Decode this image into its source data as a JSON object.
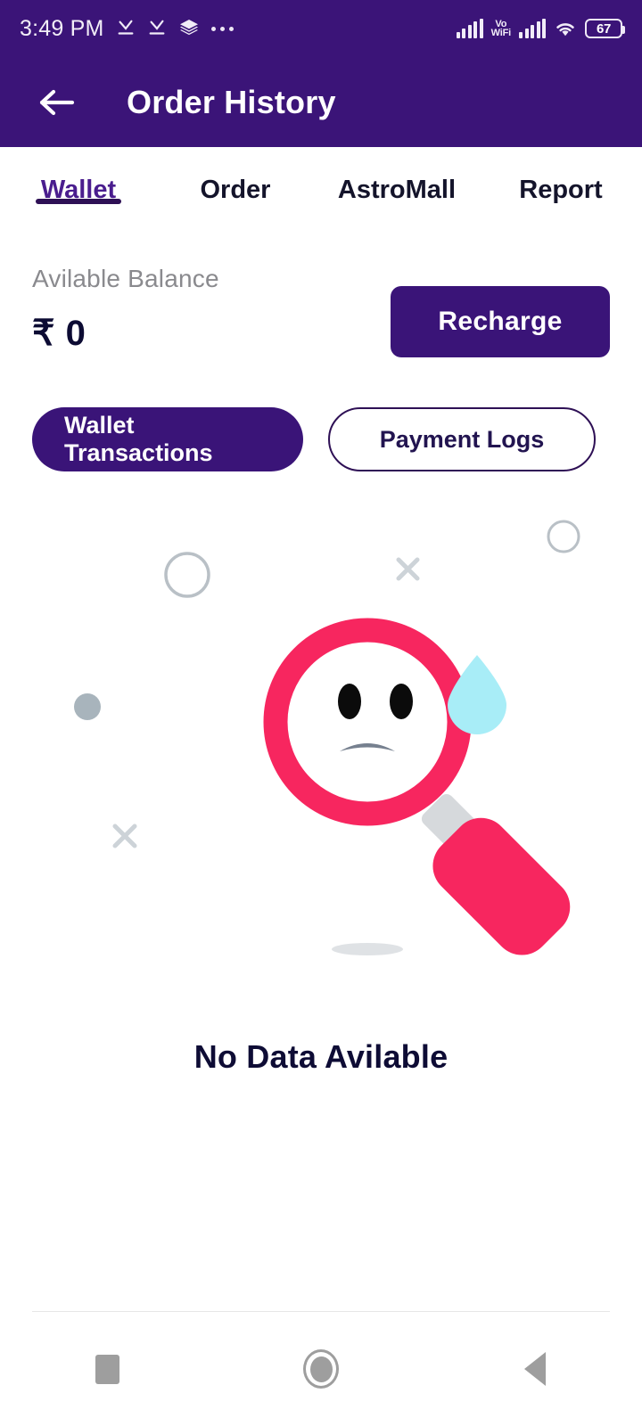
{
  "statusbar": {
    "time": "3:49 PM",
    "battery_percent": "67",
    "volte_label_line1": "Vo",
    "volte_label_line2": "WiFi",
    "icons": [
      "check-download-icon",
      "check-download-icon",
      "layers-icon",
      "more-dots-icon",
      "signal-bars-icon",
      "vowifi-icon",
      "signal-bars-icon",
      "wifi-icon",
      "battery-icon"
    ]
  },
  "appbar": {
    "title": "Order History",
    "back_icon": "arrow-left-icon"
  },
  "tabs": [
    {
      "label": "Wallet",
      "active": true
    },
    {
      "label": "Order",
      "active": false
    },
    {
      "label": "AstroMall",
      "active": false
    },
    {
      "label": "Report",
      "active": false
    }
  ],
  "wallet": {
    "balance_label": "Avilable Balance",
    "balance_amount": "₹ 0",
    "recharge_label": "Recharge"
  },
  "segments": [
    {
      "label": "Wallet Transactions",
      "selected": true
    },
    {
      "label": "Payment Logs",
      "selected": false
    }
  ],
  "empty_state": {
    "message": "No Data Avilable",
    "illustration": "magnifier-sad-face-icon"
  },
  "navbar": {
    "recents_label": "recents-square-icon",
    "home_label": "home-circle-icon",
    "back_label": "back-triangle-icon"
  },
  "colors": {
    "header_purple": "#3B1478",
    "accent_purple": "#3A1478",
    "tab_active": "#4A1D8E",
    "pink": "#F7265F",
    "drop_blue": "#A8EDF7",
    "text_dark": "#0E0C35",
    "muted_gray": "#8A8A8E"
  }
}
